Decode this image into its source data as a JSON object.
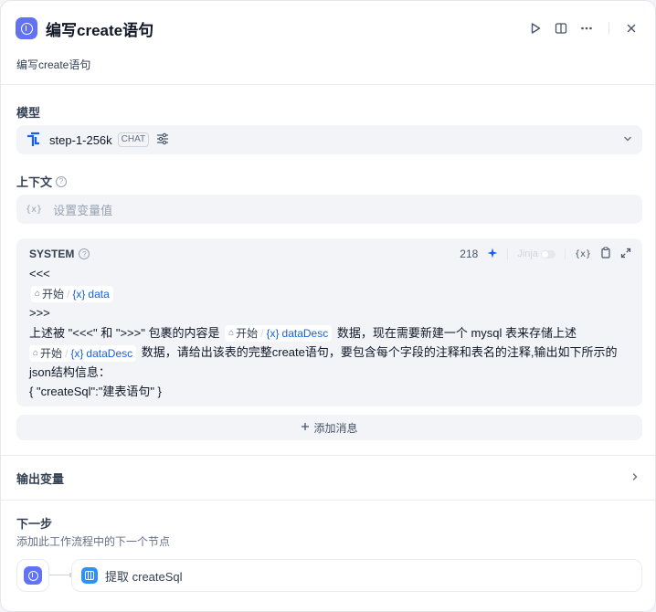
{
  "header": {
    "title": "编写create语句",
    "node_icon": "start-node-icon",
    "actions": [
      "play-icon",
      "split-view-icon",
      "more-icon",
      "close-icon"
    ]
  },
  "description": "编写create语句",
  "model": {
    "section_label": "模型",
    "name": "step-1-256k",
    "badge": "CHAT",
    "icons": [
      "model-logo-icon",
      "settings-sliders-icon",
      "chevron-down-icon"
    ]
  },
  "context": {
    "section_label": "上下文",
    "var_token": "{x}",
    "placeholder": "设置变量值"
  },
  "system": {
    "title": "SYSTEM",
    "token_count": "218",
    "jinja_label": "Jinja",
    "var_token": "{x}",
    "lines": {
      "l1": "<<<",
      "l3": ">>>",
      "l4a": "上述被 \"<<<\" 和 \">>>\" 包裹的内容是",
      "l4b": "数据，现在需要新建一个 mysql 表来存储上述",
      "l5b": "数据，请给出该表的完整create语句，要包含每个字段的注释和表名的注释,输出如下所示的",
      "l6": "json结构信息：",
      "l7": "{ \"createSql\":\"建表语句\" }"
    },
    "chip_node": "开始",
    "chip_var_prefix": "{x}",
    "chip_var_data": "data",
    "chip_var_desc": "dataDesc"
  },
  "add_message": "添加消息",
  "output": {
    "label": "输出变量"
  },
  "next_step": {
    "title": "下一步",
    "description": "添加此工作流程中的下一个节点",
    "next_node_label": "提取 createSql"
  },
  "colors": {
    "accent": "#6172f3",
    "variable": "#155eef",
    "extract_node": "#2e90fa"
  }
}
